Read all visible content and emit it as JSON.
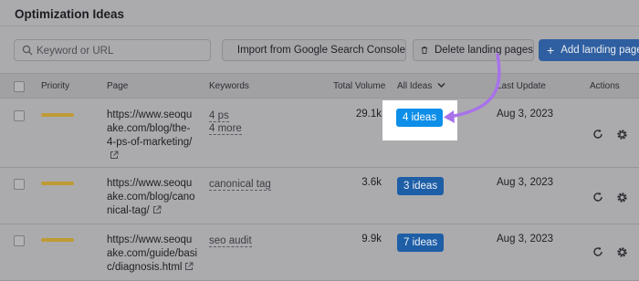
{
  "header": {
    "title": "Optimization Ideas"
  },
  "toolbar": {
    "search_placeholder": "Keyword or URL",
    "import_label": "Import from Google Search Console",
    "delete_label": "Delete landing pages",
    "add_label": "Add landing page"
  },
  "table": {
    "columns": {
      "priority": "Priority",
      "page": "Page",
      "keywords": "Keywords",
      "total_volume": "Total Volume",
      "all_ideas": "All Ideas",
      "last_update": "Last Update",
      "actions": "Actions"
    },
    "rows": [
      {
        "url_lines": [
          "https://www.seoqu",
          "ake.com/blog/the-",
          "4-ps-of-marketing/"
        ],
        "keywords": [
          "4 ps",
          "4 more"
        ],
        "volume": "29.1k",
        "ideas": "4 ideas",
        "date": "Aug 3, 2023"
      },
      {
        "url_lines": [
          "https://www.seoqu",
          "ake.com/blog/cano",
          "nical-tag/"
        ],
        "keywords": [
          "canonical tag"
        ],
        "volume": "3.6k",
        "ideas": "3 ideas",
        "date": "Aug 3, 2023"
      },
      {
        "url_lines": [
          "https://www.seoqu",
          "ake.com/guide/basi",
          "c/diagnosis.html"
        ],
        "keywords": [
          "seo audit"
        ],
        "volume": "9.9k",
        "ideas": "7 ideas",
        "date": "Aug 3, 2023"
      }
    ]
  },
  "colors": {
    "accent": "#0d8ee8",
    "annotation_arrow": "#a872ea",
    "priority": "#bf9a35"
  }
}
